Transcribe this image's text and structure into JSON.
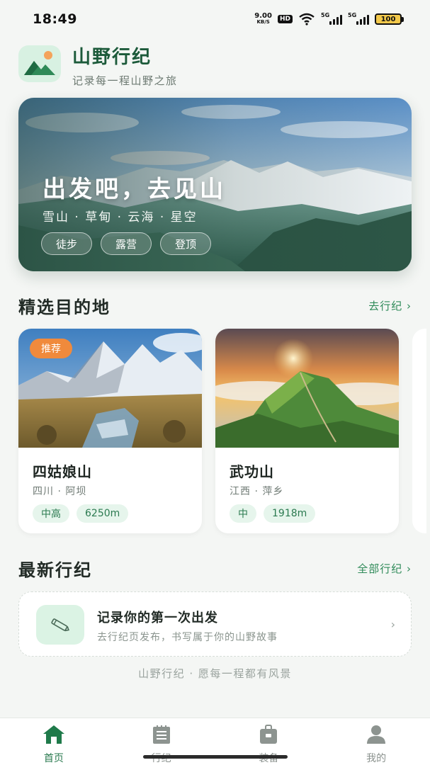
{
  "status_bar": {
    "time": "18:49",
    "net_speed_value": "9.00",
    "net_speed_unit": "KB/S",
    "hd_label": "HD",
    "signal1_label": "5G",
    "signal2_label": "5G",
    "battery": "100"
  },
  "header": {
    "title": "山野行纪",
    "subtitle": "记录每一程山野之旅",
    "logo_icon": "mountain-sun-icon"
  },
  "hero": {
    "title": "出发吧，去见山",
    "tags": "雪山 · 草甸 · 云海 · 星空",
    "chips": [
      "徒步",
      "露营",
      "登顶"
    ]
  },
  "featured": {
    "title": "精选目的地",
    "link": "去行纪 ›",
    "cards": [
      {
        "badge": "推荐",
        "name": "四姑娘山",
        "location": "四川 · 阿坝",
        "chips": [
          "中高",
          "6250m"
        ]
      },
      {
        "badge": "",
        "name": "武功山",
        "location": "江西 · 萍乡",
        "chips": [
          "中",
          "1918m"
        ]
      }
    ]
  },
  "latest": {
    "title": "最新行纪",
    "link": "全部行纪 ›",
    "card_title": "记录你的第一次出发",
    "card_desc": "去行纪页发布，书写属于你的山野故事",
    "card_icon": "pencil-icon",
    "chevron": "›"
  },
  "footer_note": "山野行纪 · 愿每一程都有风景",
  "nav": {
    "items": [
      {
        "label": "首页",
        "icon": "home-icon",
        "active": true
      },
      {
        "label": "行纪",
        "icon": "notebook-icon",
        "active": false
      },
      {
        "label": "装备",
        "icon": "backpack-icon",
        "active": false
      },
      {
        "label": "我的",
        "icon": "user-icon",
        "active": false
      }
    ]
  },
  "colors": {
    "brand": "#1c5a3a",
    "accent": "#2e8a58",
    "badge": "#f08a3c"
  }
}
